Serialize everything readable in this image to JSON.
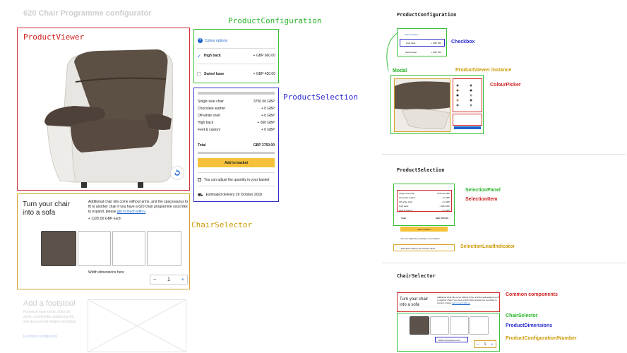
{
  "page_title": "620 Chair Programme configurator",
  "labels": {
    "product_viewer": "ProductViewer",
    "product_configuration": "ProductConfiguration",
    "product_selection": "ProductSelection",
    "chair_selector": "ChairSelector",
    "right_product_configuration": "ProductConfiguration",
    "checkbox": "Checkbox",
    "modal": "Modal",
    "product_viewer_instance": "ProductViewer instance",
    "colour_picker": "ColourPicker",
    "right_product_selection": "ProductSelection",
    "selection_panel": "SelectionPanel",
    "selection_item": "SelectionItem",
    "selection_lead_indicator": "SelectionLeadIndicator",
    "right_chair_selector": "ChairSelector",
    "common_components": "Common components",
    "chair_selector_small": "ChairSelector",
    "product_dimensions": "ProductDimensions",
    "product_configuration_number": "ProductConfiguration/Number"
  },
  "config": {
    "header": "Colour options",
    "options": [
      {
        "name": "High back",
        "price": "+ GBP 660.00",
        "checked": true
      },
      {
        "name": "Swivel base",
        "price": "+ GBP 450.00",
        "checked": false
      }
    ]
  },
  "selection": {
    "items": [
      {
        "name": "Single seat chair",
        "price": "3750.00 GBP"
      },
      {
        "name": "Chocolate leather",
        "price": "+ 0 GBP"
      },
      {
        "name": "Off-white shell",
        "price": "+ 0 GBP"
      },
      {
        "name": "High back",
        "price": "+ 660 GBP"
      },
      {
        "name": "Feet & castors",
        "price": "+ 0 GBP"
      }
    ],
    "total_label": "Total",
    "total_value": "GBP 3750.00",
    "add_button": "Add to basket",
    "note": "You can adjust the quantity in your basket",
    "delivery": "Estimated delivery 26 October 2018"
  },
  "chair_selector": {
    "title": "Turn your chair into a sofa",
    "description": "Additional chair kits come without arms, and the spacesaurus to fit to another chair if you have a 620 chair programme you'd like to expand, please",
    "link": "get in touch with u",
    "price": "+ 1225.00 GBP each",
    "width_label": "Width dimensions here",
    "quantity": "1",
    "minus": "−",
    "plus": "+"
  },
  "footstool": {
    "title": "Add a footstool",
    "body": "Footstool ease great, dolor sit amet, consectetur adipiscing elit, sed do eiusmod tempor incididunt",
    "link": "Footstool configurator →"
  },
  "mini_config": {
    "header": "Colour options",
    "options": [
      {
        "name": "High back",
        "price": "+ GBP 660"
      },
      {
        "name": "Swivel base",
        "price": "+ GBP 450"
      }
    ]
  },
  "mini_selection": {
    "items": [
      {
        "name": "Single seat chair",
        "price": "3750.00 GBP"
      },
      {
        "name": "Chocolate leather",
        "price": "+ 0 GBP"
      },
      {
        "name": "Off-white shell",
        "price": "+ 0 GBP"
      },
      {
        "name": "High back",
        "price": "+ 660 GBP"
      },
      {
        "name": "Feet & castors",
        "price": "+ 0 GBP"
      }
    ],
    "total_label": "Total",
    "total_value": "GBP 3750.00",
    "add_button": "Add to basket",
    "note": "You can adjust the quantity in your basket",
    "delivery": "Estimated delivery 26 October 2018"
  },
  "mini_chair": {
    "title": "Turn your chair into a sofa",
    "description": "Additional chair kits come without arms, and the spacesaurus to fit to another chair if you have a 620 chair programme you'd like to expand, please",
    "link": "get in touch with us",
    "width_label": "Width dimensions here",
    "quantity": "1",
    "minus": "−",
    "plus": "+"
  },
  "colors": {
    "red": "#d03030",
    "green": "#39c039",
    "blue": "#3030c8",
    "orange": "#d4a52a",
    "yellow_button": "#f5c13b",
    "link_blue": "#1a63c9"
  }
}
